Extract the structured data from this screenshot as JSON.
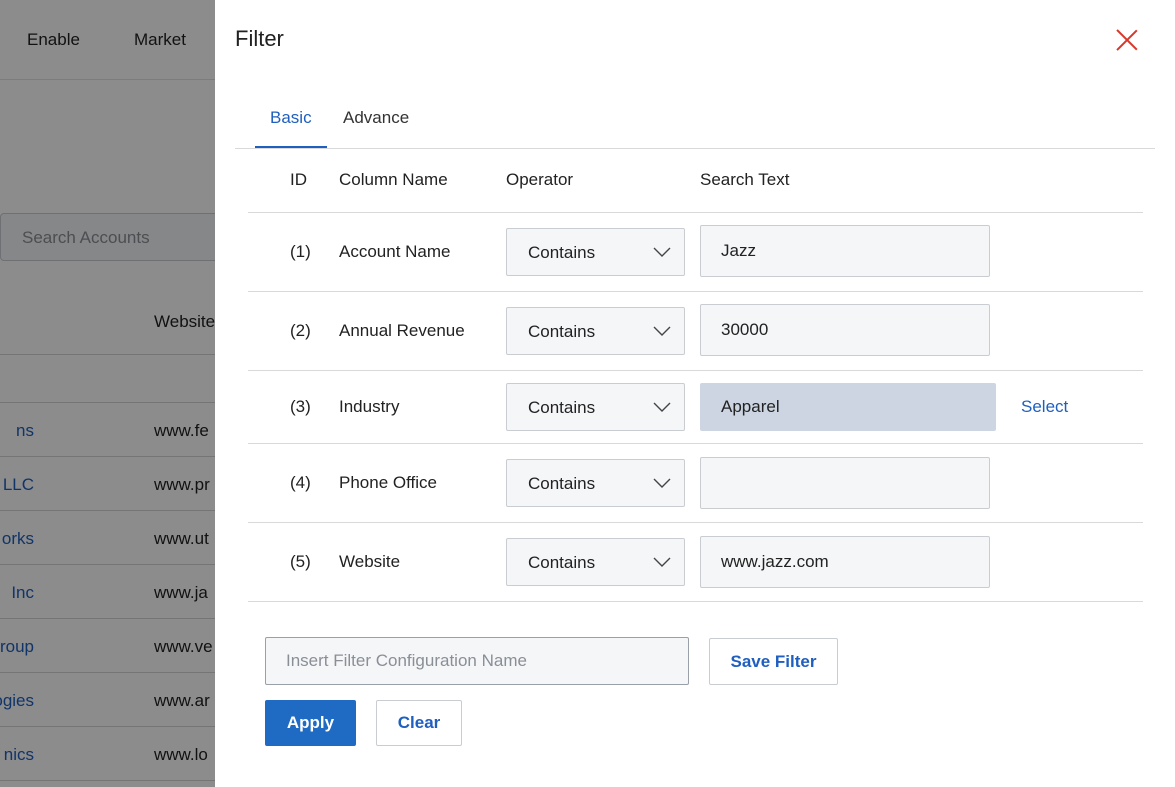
{
  "background": {
    "nav_items": [
      "Enable",
      "Market"
    ],
    "search_placeholder": "Search Accounts",
    "column_header": "Website",
    "rows": [
      {
        "account": "ns",
        "website": "www.fe"
      },
      {
        "account": "LLC",
        "website": "www.pr"
      },
      {
        "account": "orks",
        "website": "www.ut"
      },
      {
        "account": "Inc",
        "website": "www.ja"
      },
      {
        "account": "Group",
        "website": "www.ve"
      },
      {
        "account": "ogies",
        "website": "www.ar"
      },
      {
        "account": "nics",
        "website": "www.lo"
      }
    ]
  },
  "panel": {
    "title": "Filter",
    "close_icon": "close-icon",
    "tabs": [
      {
        "label": "Basic",
        "active": true
      },
      {
        "label": "Advance",
        "active": false
      }
    ],
    "columns": {
      "id": "ID",
      "column_name": "Column Name",
      "operator": "Operator",
      "search_text": "Search Text"
    },
    "filters": [
      {
        "id": "(1)",
        "column": "Account Name",
        "operator": "Contains",
        "value": "Jazz"
      },
      {
        "id": "(2)",
        "column": "Annual Revenue",
        "operator": "Contains",
        "value": "30000"
      },
      {
        "id": "(3)",
        "column": "Industry",
        "operator": "Contains",
        "value": "Apparel",
        "select_label": "Select"
      },
      {
        "id": "(4)",
        "column": "Phone Office",
        "operator": "Contains",
        "value": ""
      },
      {
        "id": "(5)",
        "column": "Website",
        "operator": "Contains",
        "value": "www.jazz.com"
      }
    ],
    "config_placeholder": "Insert Filter Configuration Name",
    "save_label": "Save Filter",
    "apply_label": "Apply",
    "clear_label": "Clear"
  },
  "colors": {
    "accent": "#1f5fbf",
    "primary_button": "#1f6bc4",
    "close": "#d9362b",
    "selected_field": "#ccd5e1"
  }
}
